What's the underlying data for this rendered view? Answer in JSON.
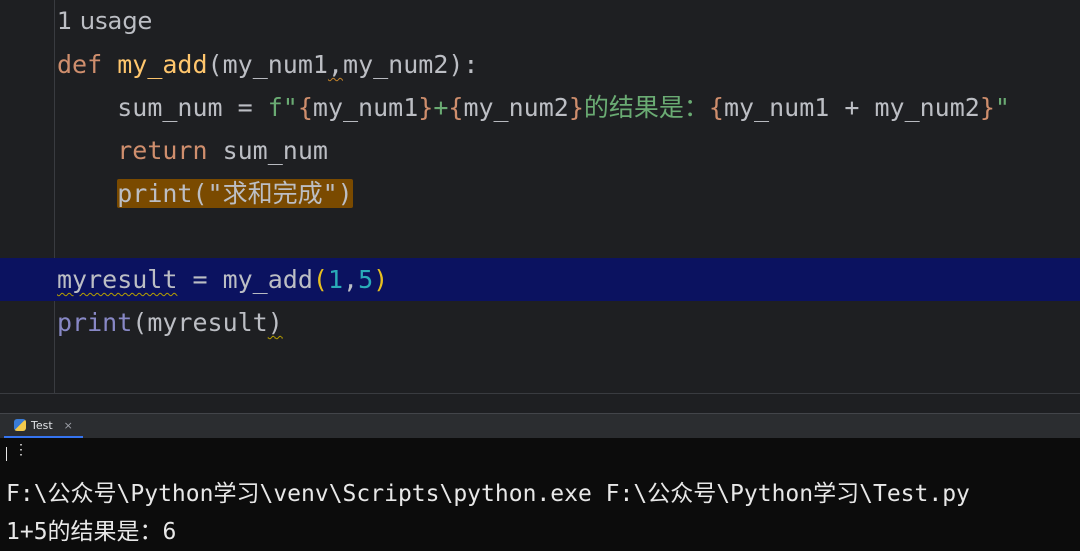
{
  "editor": {
    "usage_hint": "1 usage",
    "line1": {
      "kw": "def",
      "name": "my_add",
      "open": "(",
      "p1": "my_num1",
      "comma": ",",
      "p2": "my_num2",
      "close": "):"
    },
    "line2": {
      "var": "sum_num",
      "eq": " = ",
      "prefix": "f\"",
      "b1": "{",
      "v1": "my_num1",
      "b2": "}",
      "plus": "+",
      "b3": "{",
      "v2": "my_num2",
      "b4": "}",
      "text": "的结果是：",
      "b5": "{",
      "expr": "my_num1 + my_num2",
      "b6": "}",
      "end": "\""
    },
    "line3": {
      "kw": "return",
      "var": " sum_num"
    },
    "line4": {
      "fn": "print",
      "open": "(",
      "str": "\"求和完成\"",
      "close": ")"
    },
    "line6": {
      "var": "myresult",
      "eq": " = ",
      "fn": "my_add",
      "open": "(",
      "a1": "1",
      "comma": ",",
      "a2": "5",
      "close": ")"
    },
    "line7": {
      "fn": "print",
      "open": "(",
      "arg": "myresult",
      "close": ")"
    }
  },
  "run_panel": {
    "tab_label": "Test",
    "tab_close": "×",
    "menu_glyph": "⋮",
    "command": "F:\\公众号\\Python学习\\venv\\Scripts\\python.exe F:\\公众号\\Python学习\\Test.py",
    "output": "1+5的结果是：6"
  },
  "colors": {
    "highlight_line": "#0b1260",
    "print_highlight": "#7a4a00",
    "tab_accent": "#3574f0"
  }
}
